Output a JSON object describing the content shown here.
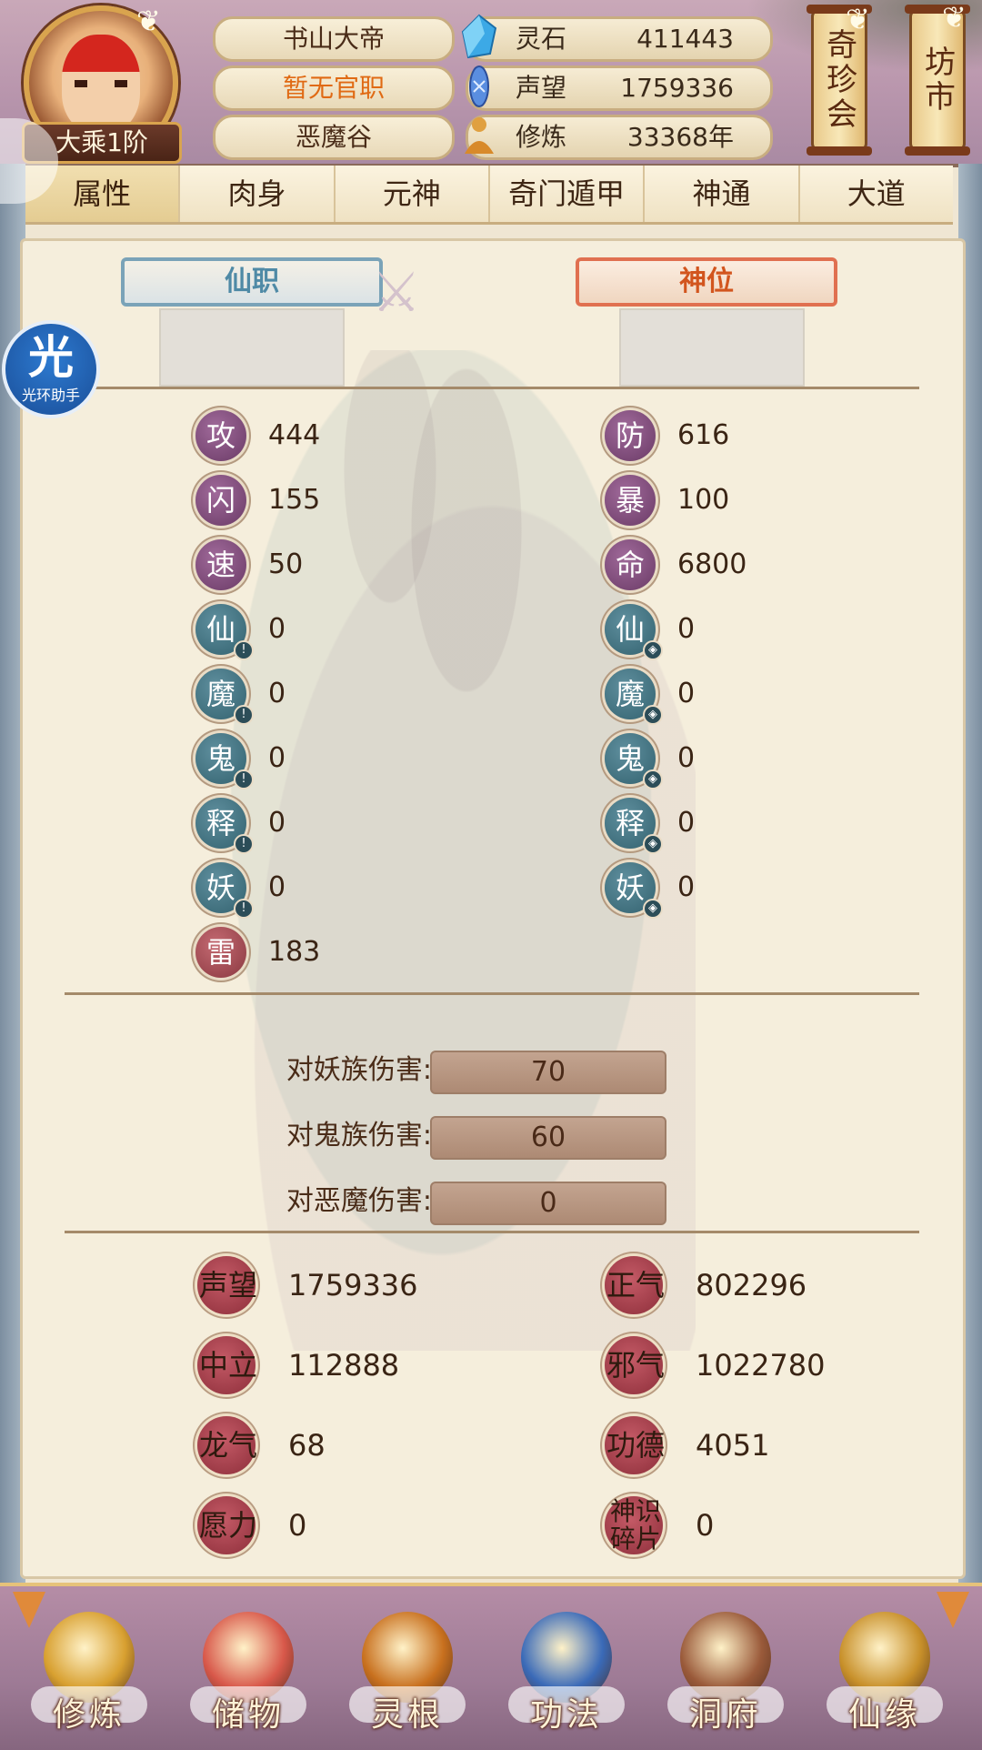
{
  "header": {
    "player_name": "书山大帝",
    "official_post": "暂无官职",
    "sect": "恶魔谷",
    "realm": "大乘1阶",
    "resources": [
      {
        "label": "灵石",
        "value": "411443",
        "icon": "spirit-stone-icon"
      },
      {
        "label": "声望",
        "value": "1759336",
        "icon": "reputation-crystal-icon"
      },
      {
        "label": "修炼",
        "value": "33368年",
        "icon": "meditation-icon"
      }
    ],
    "shortcuts": [
      "奇珍会",
      "坊市"
    ]
  },
  "tabs": [
    "属性",
    "肉身",
    "元神",
    "奇门遁甲",
    "神通",
    "大道"
  ],
  "active_tab": "属性",
  "titles": {
    "immortal_post": "仙职",
    "divine_rank": "神位"
  },
  "helper": {
    "char": "光",
    "label": "光环助手"
  },
  "stats_left": [
    {
      "label": "攻",
      "value": "444",
      "style": "purple",
      "mark": ""
    },
    {
      "label": "闪",
      "value": "155",
      "style": "purple",
      "mark": ""
    },
    {
      "label": "速",
      "value": "50",
      "style": "purple",
      "mark": ""
    },
    {
      "label": "仙",
      "value": "0",
      "style": "teal",
      "mark": "!"
    },
    {
      "label": "魔",
      "value": "0",
      "style": "teal",
      "mark": "!"
    },
    {
      "label": "鬼",
      "value": "0",
      "style": "teal",
      "mark": "!"
    },
    {
      "label": "释",
      "value": "0",
      "style": "teal",
      "mark": "!"
    },
    {
      "label": "妖",
      "value": "0",
      "style": "teal",
      "mark": "!"
    },
    {
      "label": "雷",
      "value": "183",
      "style": "red",
      "mark": ""
    }
  ],
  "stats_right": [
    {
      "label": "防",
      "value": "616",
      "style": "purple",
      "mark": ""
    },
    {
      "label": "暴",
      "value": "100",
      "style": "purple",
      "mark": ""
    },
    {
      "label": "命",
      "value": "6800",
      "style": "purple",
      "mark": ""
    },
    {
      "label": "仙",
      "value": "0",
      "style": "teal",
      "mark": "shield"
    },
    {
      "label": "魔",
      "value": "0",
      "style": "teal",
      "mark": "shield"
    },
    {
      "label": "鬼",
      "value": "0",
      "style": "teal",
      "mark": "shield"
    },
    {
      "label": "释",
      "value": "0",
      "style": "teal",
      "mark": "shield"
    },
    {
      "label": "妖",
      "value": "0",
      "style": "teal",
      "mark": "shield"
    }
  ],
  "damage": [
    {
      "label": "对妖族伤害:",
      "value": "70"
    },
    {
      "label": "对鬼族伤害:",
      "value": "60"
    },
    {
      "label": "对恶魔伤害:",
      "value": "0"
    }
  ],
  "reputation_left": [
    {
      "label": "声望",
      "value": "1759336"
    },
    {
      "label": "中立",
      "value": "112888"
    },
    {
      "label": "龙气",
      "value": "68"
    },
    {
      "label": "愿力",
      "value": "0"
    }
  ],
  "reputation_right": [
    {
      "label": "正气",
      "value": "802296"
    },
    {
      "label": "邪气",
      "value": "1022780"
    },
    {
      "label": "功德",
      "value": "4051"
    },
    {
      "label": "神识碎片",
      "value": "0"
    }
  ],
  "bottom_nav": [
    {
      "label": "修炼",
      "icon": "cultivation-figure-icon",
      "color": "#d8a030"
    },
    {
      "label": "储物",
      "icon": "storage-bag-icon",
      "color": "#d8584a"
    },
    {
      "label": "灵根",
      "icon": "spirit-root-emblem-icon",
      "color": "#c8701e"
    },
    {
      "label": "功法",
      "icon": "technique-book-icon",
      "color": "#3a6ab8"
    },
    {
      "label": "洞府",
      "icon": "cave-mansion-icon",
      "color": "#9a5a3a"
    },
    {
      "label": "仙缘",
      "icon": "gourd-icon",
      "color": "#c8902a"
    }
  ]
}
